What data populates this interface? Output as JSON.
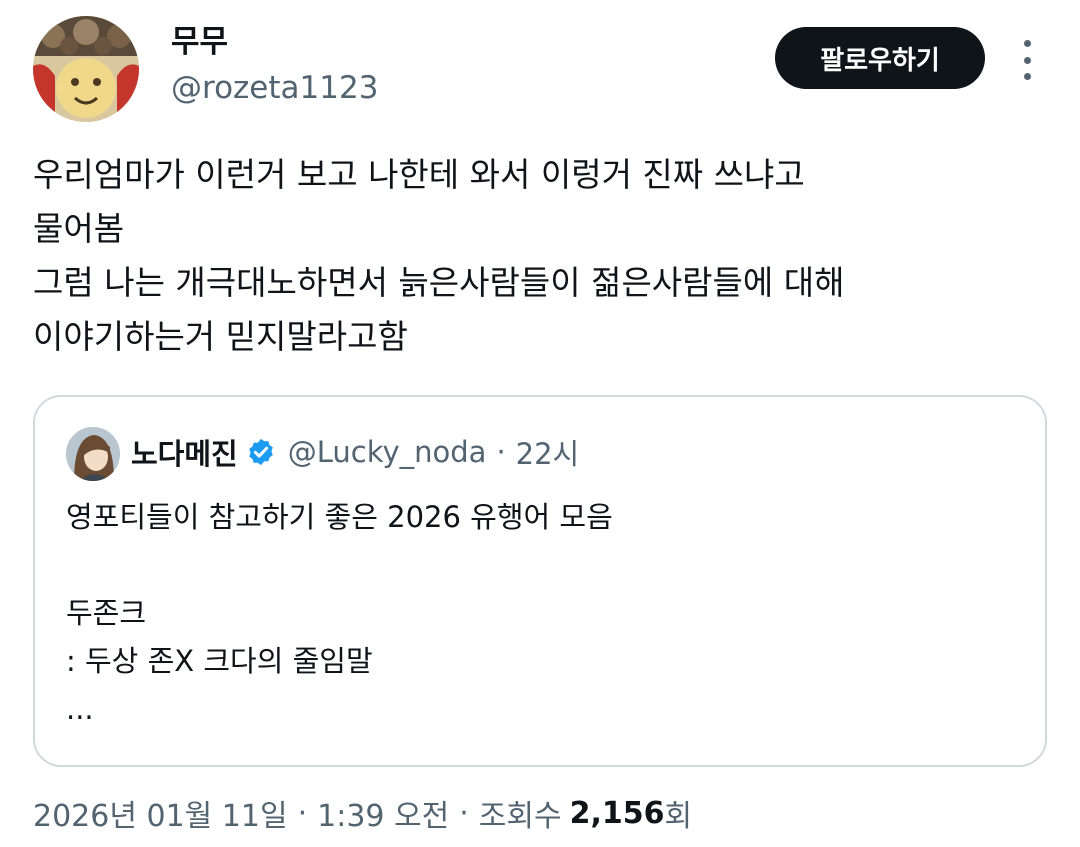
{
  "author": {
    "display_name": "무무",
    "handle": "@rozeta1123"
  },
  "actions": {
    "follow_label": "팔로우하기",
    "more_icon": "more-vertical-icon"
  },
  "tweet": {
    "lines": [
      "우리엄마가 이런거 보고 나한테 와서 이렁거 진짜 쓰냐고",
      "물어봄",
      "그럼 나는 개극대노하면서 늙은사람들이 젊은사람들에 대해",
      "이야기하는거 믿지말라고함"
    ]
  },
  "quoted": {
    "display_name": "노다메진",
    "verified_icon": "verified-badge-icon",
    "handle": "@Lucky_noda",
    "separator": "·",
    "time": "22시",
    "lines": [
      "영포티들이 참고하기 좋은 2026 유행어 모음",
      "",
      "두존크",
      ": 두상 존X 크다의 줄임말",
      "..."
    ]
  },
  "meta": {
    "date": "2026년 01월 11일",
    "separator": "·",
    "time": "1:39 오전",
    "views_label": "조회수",
    "views_count": "2,156",
    "views_suffix": "회"
  },
  "colors": {
    "text": "#0f1419",
    "secondary": "#536471",
    "border": "#cfd9de",
    "verified": "#1d9bf0",
    "button_bg": "#0f1419"
  }
}
